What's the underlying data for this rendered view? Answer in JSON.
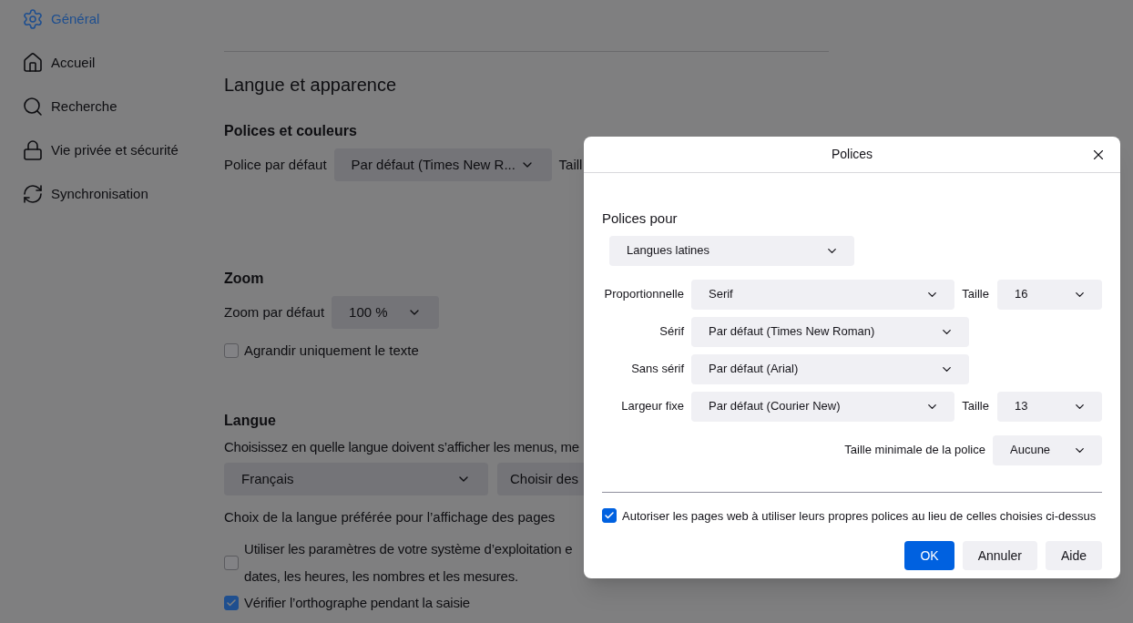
{
  "sidebar": {
    "items": [
      {
        "label": "Général",
        "selected": true
      },
      {
        "label": "Accueil",
        "selected": false
      },
      {
        "label": "Recherche",
        "selected": false
      },
      {
        "label": "Vie privée et sécurité",
        "selected": false
      },
      {
        "label": "Synchronisation",
        "selected": false
      }
    ]
  },
  "content": {
    "section_title": "Langue et apparence",
    "fonts_colors": {
      "heading": "Polices et couleurs",
      "label": "Police par défaut",
      "dropdown": "Par défaut (Times New R...",
      "size_label": "Taill"
    },
    "zoom": {
      "heading": "Zoom",
      "label": "Zoom par défaut",
      "dropdown": "100 %",
      "checkbox": {
        "label": "Agrandir uniquement le texte",
        "checked": false
      }
    },
    "language": {
      "heading": "Langue",
      "description": "Choisissez en quelle langue doivent s’afficher les menus, me",
      "dropdown": "Français",
      "button": "Choisir des",
      "pages_label": "Choix de la langue préférée pour l’affichage des pages",
      "checkboxes": [
        {
          "lines": [
            "Utiliser les paramètres de votre système d’exploitation e",
            "dates, les heures, les nombres et les mesures."
          ],
          "checked": false
        },
        {
          "lines": [
            "Vérifier l’orthographe pendant la saisie"
          ],
          "checked": true
        }
      ]
    }
  },
  "dialog": {
    "title": "Polices",
    "fonts_for_label": "Polices pour",
    "fonts_for": "Langues latines",
    "rows": [
      {
        "label": "Proportionnelle",
        "value": "Serif",
        "size_label": "Taille",
        "size": "16"
      },
      {
        "label": "Sérif",
        "value": "Par défaut (Times New Roman)"
      },
      {
        "label": "Sans sérif",
        "value": "Par défaut (Arial)"
      },
      {
        "label": "Largeur fixe",
        "value": "Par défaut (Courier New)",
        "size_label": "Taille",
        "size": "13"
      }
    ],
    "min_size_label": "Taille minimale de la police",
    "min_size": "Aucune",
    "allow_checkbox": {
      "label": "Autoriser les pages web à utiliser leurs propres polices au lieu de celles choisies ci-dessus",
      "checked": true
    },
    "buttons": [
      {
        "label": "OK",
        "kind": "primary"
      },
      {
        "label": "Annuler",
        "kind": "secondary"
      },
      {
        "label": "Aide",
        "kind": "secondary"
      }
    ]
  }
}
